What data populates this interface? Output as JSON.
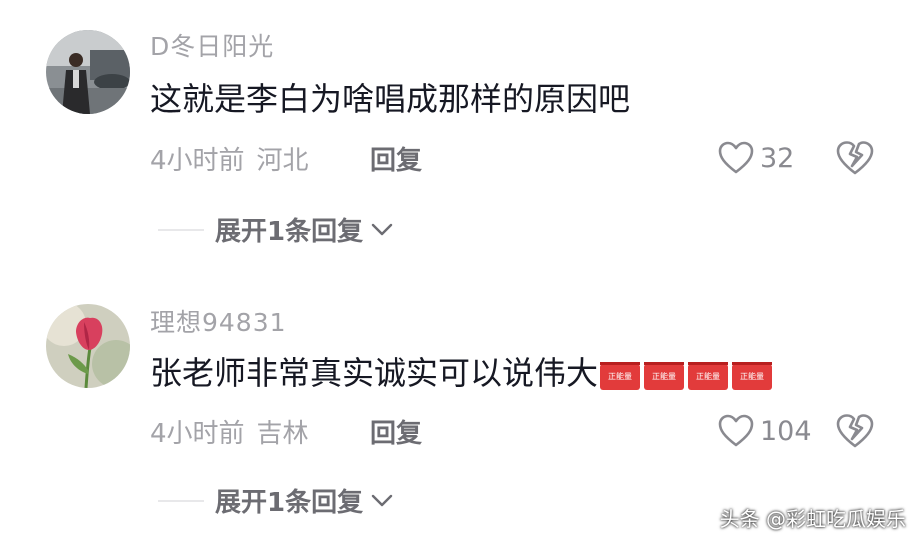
{
  "comments": [
    {
      "username": "D冬日阳光",
      "text": "这就是李白为啥唱成那样的原因吧",
      "time": "4小时前",
      "location": "河北",
      "reply_label": "回复",
      "likes": "32",
      "expand_label": "展开1条回复",
      "badges": []
    },
    {
      "username": "理想94831",
      "text": "张老师非常真实诚实可以说伟大",
      "time": "4小时前",
      "location": "吉林",
      "reply_label": "回复",
      "likes": "104",
      "expand_label": "展开1条回复",
      "badges": [
        "正能量",
        "正能量",
        "正能量",
        "正能量"
      ]
    }
  ],
  "watermark": "头条 @彩虹吃瓜娱乐",
  "colors": {
    "text": "#161823",
    "meta": "#a3a3a8",
    "reply": "#6c6c72",
    "badge": "#e23b3b"
  }
}
